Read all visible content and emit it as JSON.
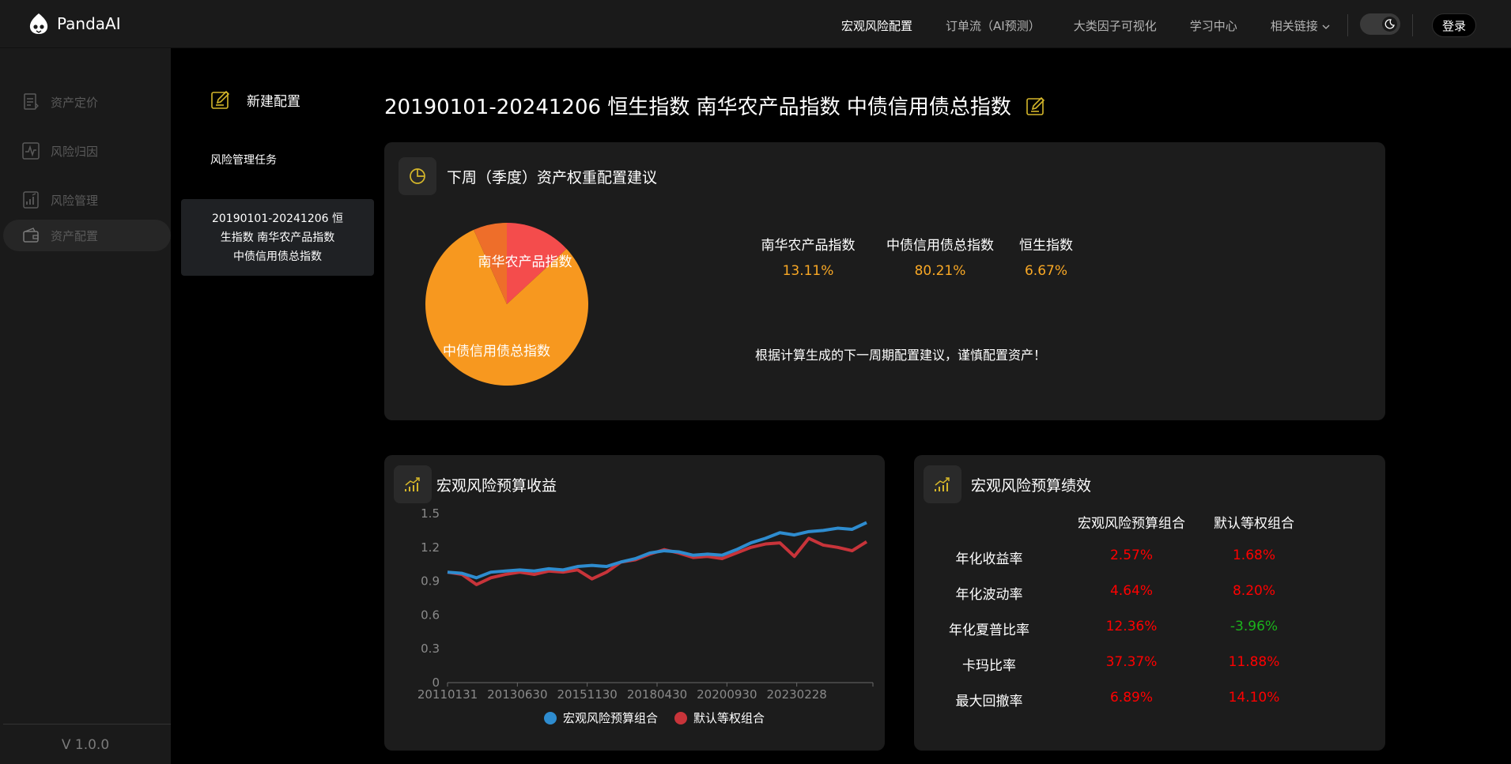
{
  "app": {
    "name": "PandaAI"
  },
  "nav": {
    "items": [
      "宏观风险配置",
      "订单流（AI预测）",
      "大类因子可视化",
      "学习中心",
      "相关链接"
    ],
    "active": "宏观风险配置",
    "login": "登录"
  },
  "sidebar": {
    "items": [
      {
        "label": "资产定价",
        "icon": "document-icon"
      },
      {
        "label": "风险归因",
        "icon": "pulse-icon"
      },
      {
        "label": "风险管理",
        "icon": "bar-chart-icon"
      },
      {
        "label": "资产配置",
        "icon": "wallet-icon"
      }
    ],
    "active": "资产配置",
    "version": "V 1.0.0"
  },
  "left_panel": {
    "new_config": "新建配置",
    "task_section_label": "风险管理任务",
    "task_card_lines": [
      "20190101-20241206 恒",
      "生指数 南华农产品指数",
      "中债信用债总指数"
    ]
  },
  "page_title": "20190101-20241206 恒生指数 南华农产品指数 中债信用债总指数",
  "weights_card": {
    "title": "下周（季度）资产权重配置建议",
    "assets": [
      {
        "name": "南华农产品指数",
        "weight": "13.11%",
        "value": 13.11,
        "color": "#f44c4c"
      },
      {
        "name": "中债信用债总指数",
        "weight": "80.21%",
        "value": 80.21,
        "color": "#f7981f"
      },
      {
        "name": "恒生指数",
        "weight": "6.67%",
        "value": 6.67,
        "color": "#ee6e2a"
      }
    ],
    "pie_labels": [
      "南华农产品指数",
      "中债信用债总指数"
    ],
    "note": "根据计算生成的下一周期配置建议，谨慎配置资产！"
  },
  "returns_card": {
    "title": "宏观风险预算收益",
    "chart_data": {
      "type": "line",
      "x": [
        "20110131",
        "20130630",
        "20151130",
        "20180430",
        "20200930",
        "20230228"
      ],
      "ylim": [
        0,
        1.5
      ],
      "yticks": [
        "0",
        "0.3",
        "0.6",
        "0.9",
        "1.2",
        "1.5"
      ],
      "grid": false,
      "legend": "bottom",
      "series": [
        {
          "name": "宏观风险预算组合",
          "color": "#2e8ccf",
          "values": [
            0.98,
            0.97,
            0.93,
            0.98,
            0.99,
            1.0,
            0.99,
            1.01,
            1.0,
            1.03,
            1.04,
            1.03,
            1.07,
            1.1,
            1.15,
            1.17,
            1.16,
            1.13,
            1.14,
            1.13,
            1.18,
            1.24,
            1.28,
            1.33,
            1.31,
            1.34,
            1.35,
            1.37,
            1.36,
            1.42
          ]
        },
        {
          "name": "默认等权组合",
          "color": "#c8343a",
          "values": [
            0.98,
            0.96,
            0.87,
            0.93,
            0.96,
            0.98,
            0.96,
            0.99,
            0.98,
            1.0,
            0.92,
            0.98,
            1.07,
            1.09,
            1.14,
            1.18,
            1.15,
            1.11,
            1.12,
            1.1,
            1.15,
            1.2,
            1.23,
            1.24,
            1.12,
            1.28,
            1.22,
            1.2,
            1.17,
            1.25
          ]
        }
      ]
    }
  },
  "perf_card": {
    "title": "宏观风险预算绩效",
    "columns": [
      "宏观风险预算组合",
      "默认等权组合"
    ],
    "rows": [
      {
        "label": "年化收益率",
        "a": "2.57%",
        "b": "1.68%",
        "a_color": "red",
        "b_color": "red"
      },
      {
        "label": "年化波动率",
        "a": "4.64%",
        "b": "8.20%",
        "a_color": "red",
        "b_color": "red"
      },
      {
        "label": "年化夏普比率",
        "a": "12.36%",
        "b": "-3.96%",
        "a_color": "red",
        "b_color": "green"
      },
      {
        "label": "卡玛比率",
        "a": "37.37%",
        "b": "11.88%",
        "a_color": "red",
        "b_color": "red"
      },
      {
        "label": "最大回撤率",
        "a": "6.89%",
        "b": "14.10%",
        "a_color": "red",
        "b_color": "red"
      }
    ]
  },
  "colors": {
    "accent": "#f9a825",
    "background": "#000000",
    "panel": "#1a1a1a",
    "card": "#1c1c1c"
  }
}
